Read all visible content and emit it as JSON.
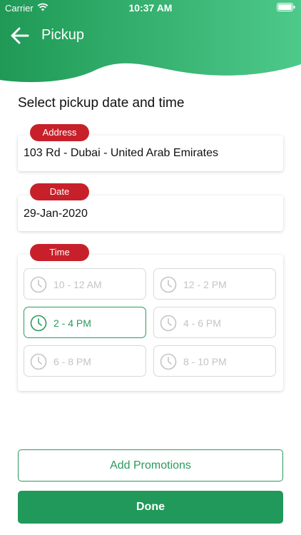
{
  "status_bar": {
    "carrier": "Carrier",
    "time": "10:37 AM"
  },
  "header": {
    "title": "Pickup"
  },
  "section_title": "Select pickup date and time",
  "address": {
    "label": "Address",
    "value": "103 Rd - Dubai - United Arab Emirates"
  },
  "date": {
    "label": "Date",
    "value": "29-Jan-2020"
  },
  "time": {
    "label": "Time",
    "slots": [
      {
        "label": "10 - 12 AM",
        "selected": false
      },
      {
        "label": "12 - 2 PM",
        "selected": false
      },
      {
        "label": "2 - 4 PM",
        "selected": true
      },
      {
        "label": "4 - 6 PM",
        "selected": false
      },
      {
        "label": "6 - 8 PM",
        "selected": false
      },
      {
        "label": "8 - 10 PM",
        "selected": false
      }
    ]
  },
  "buttons": {
    "add_promotions": "Add Promotions",
    "done": "Done"
  },
  "colors": {
    "primary_green": "#21995a",
    "header_green_light": "#4dc98a",
    "badge_red": "#c8202b",
    "disabled_gray": "#c4c4c4"
  }
}
